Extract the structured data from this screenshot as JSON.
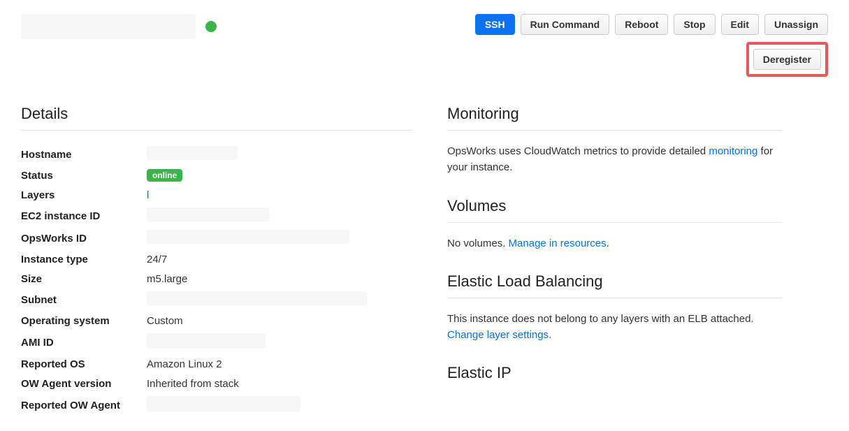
{
  "header": {
    "buttons": {
      "ssh": "SSH",
      "run_command": "Run Command",
      "reboot": "Reboot",
      "stop": "Stop",
      "edit": "Edit",
      "unassign": "Unassign",
      "deregister": "Deregister"
    }
  },
  "details": {
    "title": "Details",
    "labels": {
      "hostname": "Hostname",
      "status": "Status",
      "layers": "Layers",
      "ec2_instance_id": "EC2 instance ID",
      "opsworks_id": "OpsWorks ID",
      "instance_type": "Instance type",
      "size": "Size",
      "subnet": "Subnet",
      "operating_system": "Operating system",
      "ami_id": "AMI ID",
      "reported_os": "Reported OS",
      "ow_agent_version": "OW Agent version",
      "reported_ow_agent": "Reported OW Agent"
    },
    "values": {
      "status_badge": "online",
      "layers_link": "l",
      "instance_type": "24/7",
      "size": "m5.large",
      "operating_system": "Custom",
      "reported_os": "Amazon Linux 2",
      "ow_agent_version": "Inherited from stack"
    }
  },
  "monitoring": {
    "title": "Monitoring",
    "text_before": "OpsWorks uses CloudWatch metrics to provide detailed ",
    "link": "monitoring",
    "text_after": " for your instance."
  },
  "volumes": {
    "title": "Volumes",
    "text_before": "No volumes. ",
    "link": "Manage in resources",
    "text_after": "."
  },
  "elb": {
    "title": "Elastic Load Balancing",
    "text_before": "This instance does not belong to any layers with an ELB attached. ",
    "link": "Change layer settings",
    "text_after": "."
  },
  "eip": {
    "title": "Elastic IP"
  }
}
